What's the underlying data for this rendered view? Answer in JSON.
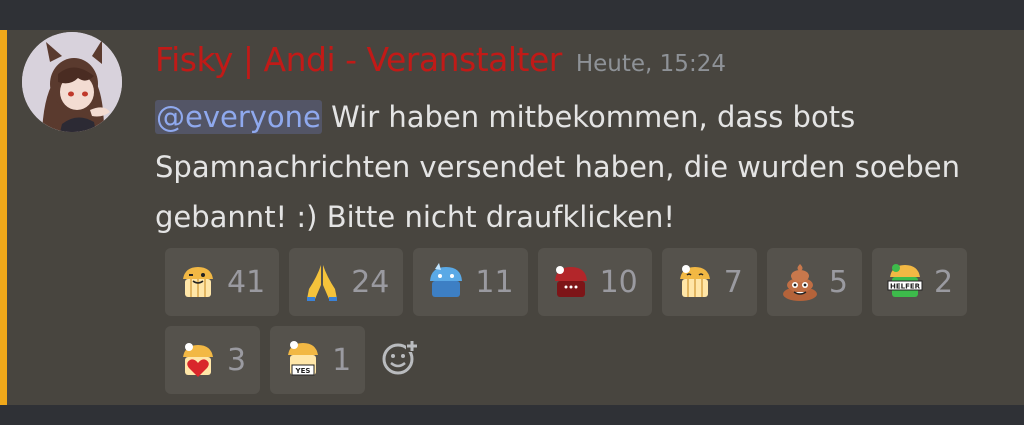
{
  "message": {
    "author": "Fisky | Andi - Veranstalter",
    "timestamp": "Heute, 15:24",
    "mention": "@everyone",
    "text": " Wir haben mitbekommen, dass bots Spamnachrichten versendet haben, die wurden soeben gebannt! :) Bitte nicht draufklicken!"
  },
  "colors": {
    "author": "#c11a17",
    "mention_stripe": "#f0a81a",
    "message_bg": "#48453f",
    "mention_text": "#8fa9ee"
  },
  "reactions": [
    {
      "emoji": "muffin-wink-emoji",
      "count": "41"
    },
    {
      "emoji": "folded-hands-emoji",
      "count": "24"
    },
    {
      "emoji": "blue-muffin-emoji",
      "count": "11"
    },
    {
      "emoji": "red-muffin-emoji",
      "count": "10"
    },
    {
      "emoji": "muffin-smile-emoji",
      "count": "7"
    },
    {
      "emoji": "pile-of-poo-emoji",
      "count": "5"
    },
    {
      "emoji": "helfer-muffin-emoji",
      "count": "2",
      "badge": "HELFER"
    },
    {
      "emoji": "muffin-heart-emoji",
      "count": "3"
    },
    {
      "emoji": "muffin-yes-emoji",
      "count": "1",
      "badge": "YES"
    }
  ],
  "add_reaction_icon": "add-reaction-icon"
}
